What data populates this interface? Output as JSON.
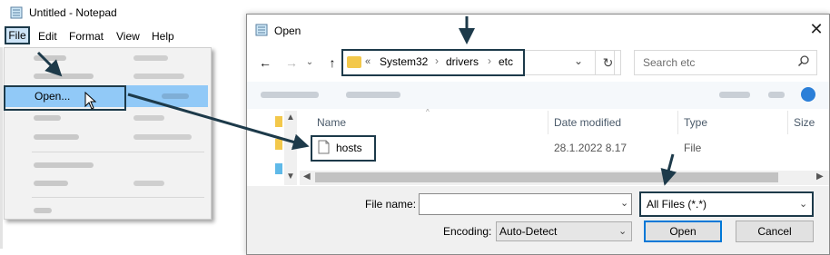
{
  "notepad": {
    "title": "Untitled - Notepad",
    "menu": [
      "File",
      "Edit",
      "Format",
      "View",
      "Help"
    ],
    "file_menu": {
      "highlighted_item": "Open..."
    }
  },
  "dialog": {
    "title": "Open",
    "breadcrumb": [
      "System32",
      "drivers",
      "etc"
    ],
    "breadcrumb_prefix": "«",
    "search_placeholder": "Search etc",
    "columns": [
      "Name",
      "Date modified",
      "Type",
      "Size"
    ],
    "files": [
      {
        "name": "hosts",
        "date": "28.1.2022 8.17",
        "type": "File"
      }
    ],
    "file_name_label": "File name:",
    "file_name_value": "",
    "file_type_value": "All Files  (*.*)",
    "encoding_label": "Encoding:",
    "encoding_value": "Auto-Detect",
    "open_button": "Open",
    "cancel_button": "Cancel"
  },
  "colors": {
    "highlight_border": "#1d3a4a",
    "menu_highlight": "#91c9f7",
    "folder": "#f3c84b",
    "accent": "#0078d7"
  }
}
